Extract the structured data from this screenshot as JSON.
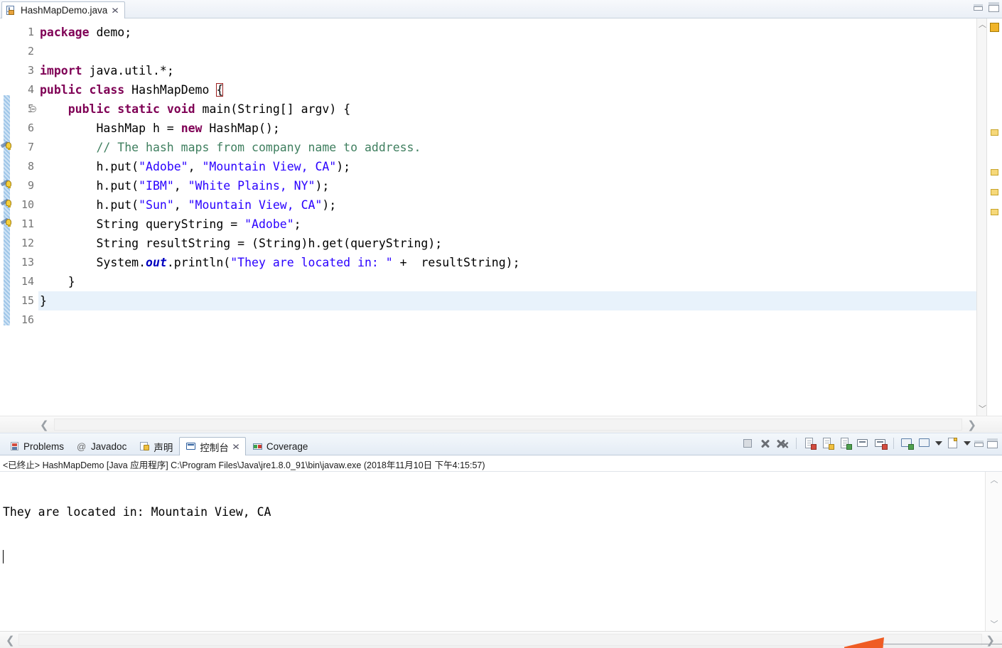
{
  "window": {
    "minimize_label": "minimize",
    "maximize_label": "maximize"
  },
  "editor": {
    "tab": {
      "title": "HashMapDemo.java",
      "icon": "java-file-icon",
      "close_label": "✕"
    },
    "current_line": 15,
    "total_lines": 16,
    "line_numbers": [
      "1",
      "2",
      "3",
      "4",
      "5",
      "6",
      "7",
      "8",
      "9",
      "10",
      "11",
      "12",
      "13",
      "14",
      "15",
      "16"
    ],
    "fold_markers": [
      5
    ],
    "warning_lines": [
      6,
      8,
      9,
      10
    ],
    "changed_lines": [
      4,
      5,
      6,
      7,
      8,
      9,
      10,
      11,
      12,
      13,
      14,
      15
    ],
    "code": [
      {
        "n": 1,
        "tokens": [
          {
            "t": "package",
            "c": "kw"
          },
          {
            "t": " demo;",
            "c": "pl"
          }
        ]
      },
      {
        "n": 2,
        "tokens": []
      },
      {
        "n": 3,
        "tokens": [
          {
            "t": "import",
            "c": "kw"
          },
          {
            "t": " java.util.*;",
            "c": "pl"
          }
        ]
      },
      {
        "n": 4,
        "tokens": [
          {
            "t": "public",
            "c": "kw"
          },
          {
            "t": " ",
            "c": "pl"
          },
          {
            "t": "class",
            "c": "kw"
          },
          {
            "t": " HashMapDemo ",
            "c": "pl"
          },
          {
            "t": "{",
            "c": "brace"
          }
        ]
      },
      {
        "n": 5,
        "tokens": [
          {
            "t": "    ",
            "c": "pl"
          },
          {
            "t": "public",
            "c": "kw"
          },
          {
            "t": " ",
            "c": "pl"
          },
          {
            "t": "static",
            "c": "kw"
          },
          {
            "t": " ",
            "c": "pl"
          },
          {
            "t": "void",
            "c": "kw"
          },
          {
            "t": " main(String[] argv) {",
            "c": "pl"
          }
        ]
      },
      {
        "n": 6,
        "tokens": [
          {
            "t": "        HashMap h = ",
            "c": "pl"
          },
          {
            "t": "new",
            "c": "kw"
          },
          {
            "t": " HashMap();",
            "c": "pl"
          }
        ]
      },
      {
        "n": 7,
        "tokens": [
          {
            "t": "        // The hash maps from company name to address.",
            "c": "cmt"
          }
        ]
      },
      {
        "n": 8,
        "tokens": [
          {
            "t": "        h.put(",
            "c": "pl"
          },
          {
            "t": "\"Adobe\"",
            "c": "str"
          },
          {
            "t": ", ",
            "c": "pl"
          },
          {
            "t": "\"Mountain View, CA\"",
            "c": "str"
          },
          {
            "t": ");",
            "c": "pl"
          }
        ]
      },
      {
        "n": 9,
        "tokens": [
          {
            "t": "        h.put(",
            "c": "pl"
          },
          {
            "t": "\"IBM\"",
            "c": "str"
          },
          {
            "t": ", ",
            "c": "pl"
          },
          {
            "t": "\"White Plains, NY\"",
            "c": "str"
          },
          {
            "t": ");",
            "c": "pl"
          }
        ]
      },
      {
        "n": 10,
        "tokens": [
          {
            "t": "        h.put(",
            "c": "pl"
          },
          {
            "t": "\"Sun\"",
            "c": "str"
          },
          {
            "t": ", ",
            "c": "pl"
          },
          {
            "t": "\"Mountain View, CA\"",
            "c": "str"
          },
          {
            "t": ");",
            "c": "pl"
          }
        ]
      },
      {
        "n": 11,
        "tokens": [
          {
            "t": "        String queryString = ",
            "c": "pl"
          },
          {
            "t": "\"Adobe\"",
            "c": "str"
          },
          {
            "t": ";",
            "c": "pl"
          }
        ]
      },
      {
        "n": 12,
        "tokens": [
          {
            "t": "        String resultString = (String)h.get(queryString);",
            "c": "pl"
          }
        ]
      },
      {
        "n": 13,
        "tokens": [
          {
            "t": "        System.",
            "c": "pl"
          },
          {
            "t": "out",
            "c": "fld"
          },
          {
            "t": ".println(",
            "c": "pl"
          },
          {
            "t": "\"They are located in: \"",
            "c": "str"
          },
          {
            "t": " +  resultString);",
            "c": "pl"
          }
        ]
      },
      {
        "n": 14,
        "tokens": [
          {
            "t": "    }",
            "c": "pl"
          }
        ]
      },
      {
        "n": 15,
        "tokens": [
          {
            "t": "}",
            "c": "pl"
          }
        ]
      },
      {
        "n": 16,
        "tokens": []
      }
    ],
    "hscroll": {
      "left_arrow": "❮",
      "right_arrow": "❯"
    },
    "overview_ruler_marks": [
      "warning",
      "warning",
      "warning",
      "warning"
    ],
    "vscroll": {
      "up_arrow": "︿",
      "down_arrow": "﹀"
    }
  },
  "console_panel": {
    "tabs": [
      {
        "label": "Problems",
        "icon": "problems-icon",
        "active": false,
        "closable": false
      },
      {
        "label": "Javadoc",
        "icon": "javadoc-at-icon",
        "active": false,
        "closable": false
      },
      {
        "label": "声明",
        "icon": "declaration-icon",
        "active": false,
        "closable": false
      },
      {
        "label": "控制台",
        "icon": "console-icon",
        "active": true,
        "closable": true
      },
      {
        "label": "Coverage",
        "icon": "coverage-icon",
        "active": false,
        "closable": false
      }
    ],
    "tab_close_label": "✕",
    "toolbar": [
      {
        "name": "terminate-button",
        "icon": "stop-square-icon"
      },
      {
        "name": "remove-launch-button",
        "icon": "remove-x-icon"
      },
      {
        "name": "remove-all-terminated-button",
        "icon": "remove-all-x-icon"
      },
      {
        "name": "clear-console-button",
        "icon": "clear-console-icon"
      },
      {
        "name": "scroll-lock-button",
        "icon": "scroll-lock-icon"
      },
      {
        "name": "word-wrap-button",
        "icon": "word-wrap-icon"
      },
      {
        "name": "show-console-on-output-button",
        "icon": "show-console-stdout-icon"
      },
      {
        "name": "show-console-on-error-button",
        "icon": "show-console-stderr-icon"
      },
      {
        "name": "pin-console-button",
        "icon": "pin-console-icon"
      },
      {
        "name": "display-selected-console-button",
        "icon": "display-console-icon"
      },
      {
        "name": "display-selected-console-menu",
        "icon": "chevron-down-icon"
      },
      {
        "name": "open-console-button",
        "icon": "new-console-icon"
      },
      {
        "name": "open-console-menu",
        "icon": "chevron-down-icon"
      },
      {
        "name": "minimize-panel-button",
        "icon": "minimize-icon"
      },
      {
        "name": "maximize-panel-button",
        "icon": "maximize-icon"
      }
    ],
    "launch_header": "<已终止> HashMapDemo [Java 应用程序] C:\\Program Files\\Java\\jre1.8.0_91\\bin\\javaw.exe  (2018年11月10日 下午4:15:57)",
    "output_lines": [
      "They are located in: Mountain View, CA"
    ],
    "vscroll": {
      "up_arrow": "︿",
      "down_arrow": "﹀"
    },
    "hscroll": {
      "left_arrow": "❮",
      "right_arrow": "❯"
    }
  },
  "colors": {
    "keyword": "#7f0055",
    "string": "#2a00ff",
    "comment": "#3f7f5f",
    "static_field": "#0000c0",
    "current_line_bg": "#e8f2fb",
    "warning_marker": "#f6d87a",
    "accent_orange": "#ef5c23",
    "tab_border": "#b8c4d2"
  }
}
